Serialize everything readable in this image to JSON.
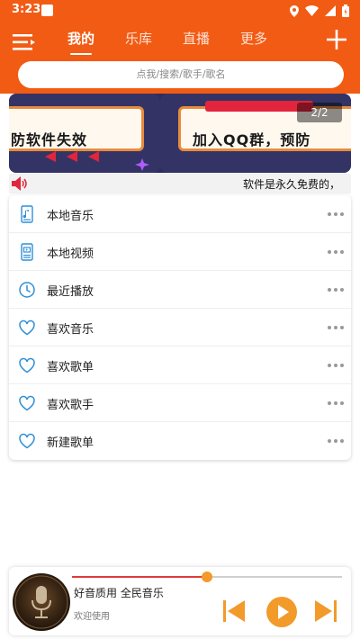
{
  "status_bar": {
    "time": "3:23"
  },
  "tabs": [
    {
      "label": "我的",
      "active": true
    },
    {
      "label": "乐库",
      "active": false
    },
    {
      "label": "直播",
      "active": false
    },
    {
      "label": "更多",
      "active": false
    }
  ],
  "search": {
    "placeholder": "点我/搜索/歌手/歌名"
  },
  "banner": {
    "page_indicator": "2/2",
    "slide_left_text": "防软件失效",
    "slide_right_text": "加入QQ群，预防"
  },
  "notice": {
    "text": "软件是永久免费的，"
  },
  "menu": [
    {
      "label": "本地音乐",
      "icon": "music-file-icon"
    },
    {
      "label": "本地视频",
      "icon": "video-file-icon"
    },
    {
      "label": "最近播放",
      "icon": "clock-icon"
    },
    {
      "label": "喜欢音乐",
      "icon": "heart-icon"
    },
    {
      "label": "喜欢歌单",
      "icon": "heart-icon"
    },
    {
      "label": "喜欢歌手",
      "icon": "heart-icon"
    },
    {
      "label": "新建歌单",
      "icon": "heart-icon"
    }
  ],
  "player": {
    "title": "好音质用 全民音乐",
    "subtitle": "欢迎使用",
    "progress": 0.5
  },
  "colors": {
    "accent": "#f25b14",
    "icon_blue": "#2d8fd8",
    "control_orange": "#f29a2a"
  }
}
